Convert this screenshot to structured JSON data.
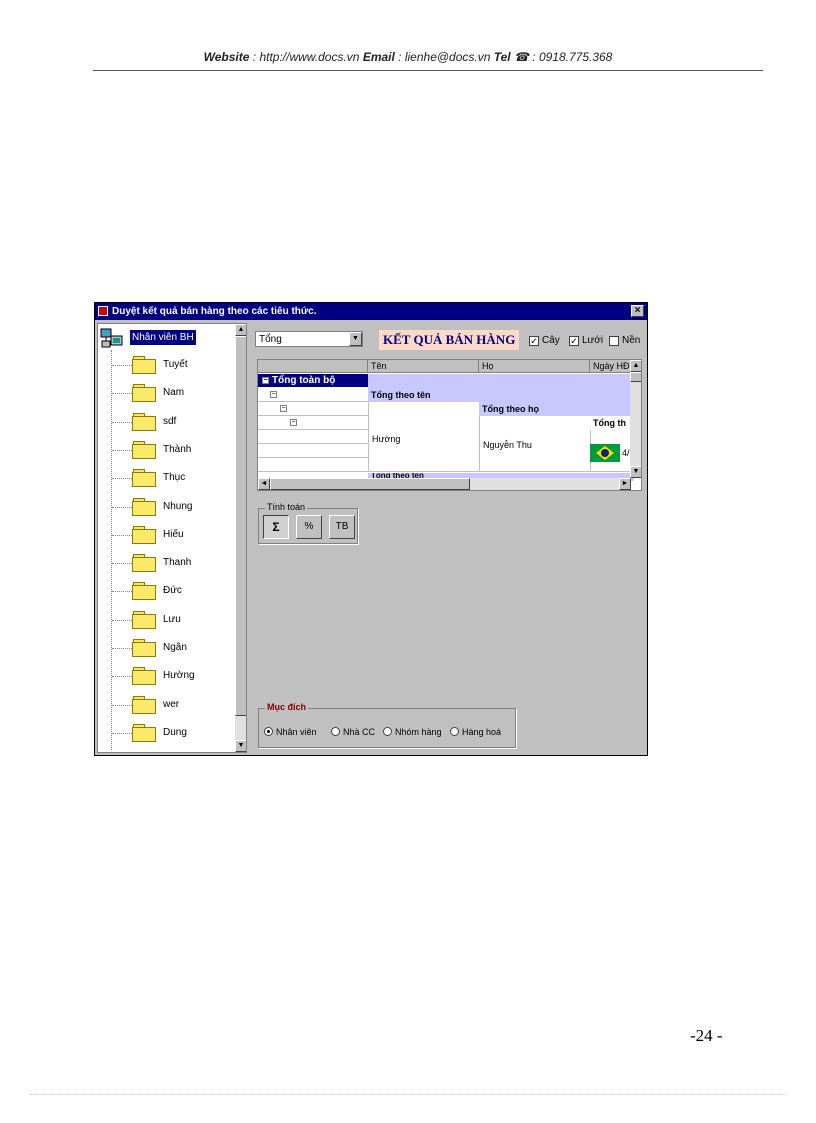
{
  "header": {
    "website_label": "Website",
    "website_value": " : http://www.docs.vn  ",
    "email_label": "Email",
    "email_value": "  : lienhe@docs.vn  ",
    "tel_label": "Tel",
    "tel_value": " ☎ : 0918.775.368"
  },
  "window": {
    "title": "Duyệt kết quả bán hàng theo các tiêu thức.",
    "close": "×"
  },
  "tree": {
    "root_label": "Nhân viên BH",
    "items": [
      "Tuyết",
      "Nam",
      "sdf",
      "Thành",
      "Thục",
      "Nhung",
      "Hiếu",
      "Thanh",
      "Đức",
      "Lưu",
      "Ngân",
      "Hường",
      "wer",
      "Dung"
    ]
  },
  "filter": {
    "value": "Tổng"
  },
  "result_title": "KẾT QUẢ BÁN HÀNG",
  "options": [
    {
      "label": "Cây",
      "checked": true
    },
    {
      "label": "Lưới",
      "checked": true
    },
    {
      "label": "Nền",
      "checked": false
    }
  ],
  "grid": {
    "columns": [
      "",
      "Tên",
      "Họ",
      "Ngày HĐ"
    ],
    "total_all": "Tổng toàn bộ",
    "total_by_name": "Tổng theo tên",
    "total_by_surname": "Tổng theo họ",
    "total_third": "Tổng th",
    "name_value": "Hường",
    "surname_value": "Nguyễn Thu",
    "date_partial": "4/",
    "next_band": "Tổng theo tên"
  },
  "calc": {
    "legend": "Tính toán",
    "buttons": [
      "Σ",
      "%",
      "TB"
    ]
  },
  "purpose": {
    "legend": "Mục đích",
    "options": [
      {
        "label": "Nhân viên",
        "selected": true
      },
      {
        "label": "Nhà CC",
        "selected": false
      },
      {
        "label": "Nhóm hàng",
        "selected": false
      },
      {
        "label": "Hàng hoá",
        "selected": false
      }
    ]
  },
  "page_number": "-24 -"
}
